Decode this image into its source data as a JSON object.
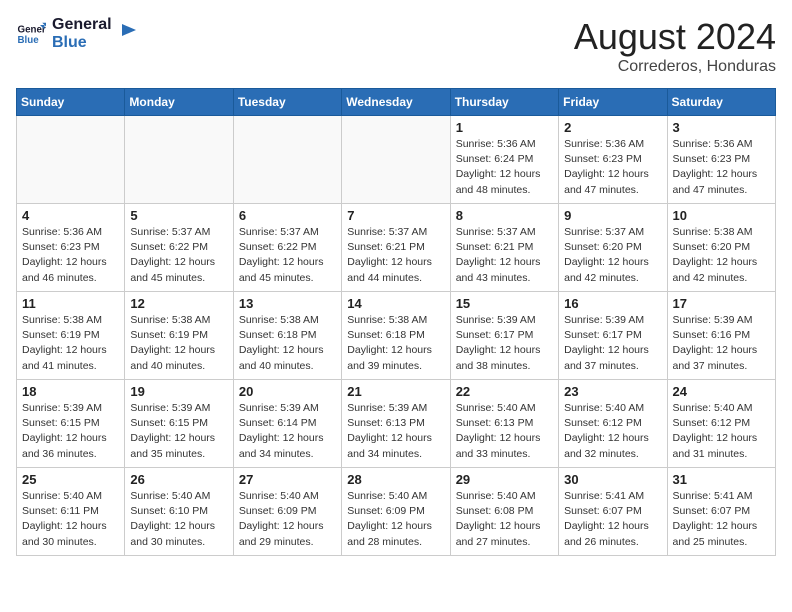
{
  "header": {
    "logo_general": "General",
    "logo_blue": "Blue",
    "month_year": "August 2024",
    "location": "Correderos, Honduras"
  },
  "weekdays": [
    "Sunday",
    "Monday",
    "Tuesday",
    "Wednesday",
    "Thursday",
    "Friday",
    "Saturday"
  ],
  "weeks": [
    [
      {
        "day": "",
        "info": ""
      },
      {
        "day": "",
        "info": ""
      },
      {
        "day": "",
        "info": ""
      },
      {
        "day": "",
        "info": ""
      },
      {
        "day": "1",
        "info": "Sunrise: 5:36 AM\nSunset: 6:24 PM\nDaylight: 12 hours\nand 48 minutes."
      },
      {
        "day": "2",
        "info": "Sunrise: 5:36 AM\nSunset: 6:23 PM\nDaylight: 12 hours\nand 47 minutes."
      },
      {
        "day": "3",
        "info": "Sunrise: 5:36 AM\nSunset: 6:23 PM\nDaylight: 12 hours\nand 47 minutes."
      }
    ],
    [
      {
        "day": "4",
        "info": "Sunrise: 5:36 AM\nSunset: 6:23 PM\nDaylight: 12 hours\nand 46 minutes."
      },
      {
        "day": "5",
        "info": "Sunrise: 5:37 AM\nSunset: 6:22 PM\nDaylight: 12 hours\nand 45 minutes."
      },
      {
        "day": "6",
        "info": "Sunrise: 5:37 AM\nSunset: 6:22 PM\nDaylight: 12 hours\nand 45 minutes."
      },
      {
        "day": "7",
        "info": "Sunrise: 5:37 AM\nSunset: 6:21 PM\nDaylight: 12 hours\nand 44 minutes."
      },
      {
        "day": "8",
        "info": "Sunrise: 5:37 AM\nSunset: 6:21 PM\nDaylight: 12 hours\nand 43 minutes."
      },
      {
        "day": "9",
        "info": "Sunrise: 5:37 AM\nSunset: 6:20 PM\nDaylight: 12 hours\nand 42 minutes."
      },
      {
        "day": "10",
        "info": "Sunrise: 5:38 AM\nSunset: 6:20 PM\nDaylight: 12 hours\nand 42 minutes."
      }
    ],
    [
      {
        "day": "11",
        "info": "Sunrise: 5:38 AM\nSunset: 6:19 PM\nDaylight: 12 hours\nand 41 minutes."
      },
      {
        "day": "12",
        "info": "Sunrise: 5:38 AM\nSunset: 6:19 PM\nDaylight: 12 hours\nand 40 minutes."
      },
      {
        "day": "13",
        "info": "Sunrise: 5:38 AM\nSunset: 6:18 PM\nDaylight: 12 hours\nand 40 minutes."
      },
      {
        "day": "14",
        "info": "Sunrise: 5:38 AM\nSunset: 6:18 PM\nDaylight: 12 hours\nand 39 minutes."
      },
      {
        "day": "15",
        "info": "Sunrise: 5:39 AM\nSunset: 6:17 PM\nDaylight: 12 hours\nand 38 minutes."
      },
      {
        "day": "16",
        "info": "Sunrise: 5:39 AM\nSunset: 6:17 PM\nDaylight: 12 hours\nand 37 minutes."
      },
      {
        "day": "17",
        "info": "Sunrise: 5:39 AM\nSunset: 6:16 PM\nDaylight: 12 hours\nand 37 minutes."
      }
    ],
    [
      {
        "day": "18",
        "info": "Sunrise: 5:39 AM\nSunset: 6:15 PM\nDaylight: 12 hours\nand 36 minutes."
      },
      {
        "day": "19",
        "info": "Sunrise: 5:39 AM\nSunset: 6:15 PM\nDaylight: 12 hours\nand 35 minutes."
      },
      {
        "day": "20",
        "info": "Sunrise: 5:39 AM\nSunset: 6:14 PM\nDaylight: 12 hours\nand 34 minutes."
      },
      {
        "day": "21",
        "info": "Sunrise: 5:39 AM\nSunset: 6:13 PM\nDaylight: 12 hours\nand 34 minutes."
      },
      {
        "day": "22",
        "info": "Sunrise: 5:40 AM\nSunset: 6:13 PM\nDaylight: 12 hours\nand 33 minutes."
      },
      {
        "day": "23",
        "info": "Sunrise: 5:40 AM\nSunset: 6:12 PM\nDaylight: 12 hours\nand 32 minutes."
      },
      {
        "day": "24",
        "info": "Sunrise: 5:40 AM\nSunset: 6:12 PM\nDaylight: 12 hours\nand 31 minutes."
      }
    ],
    [
      {
        "day": "25",
        "info": "Sunrise: 5:40 AM\nSunset: 6:11 PM\nDaylight: 12 hours\nand 30 minutes."
      },
      {
        "day": "26",
        "info": "Sunrise: 5:40 AM\nSunset: 6:10 PM\nDaylight: 12 hours\nand 30 minutes."
      },
      {
        "day": "27",
        "info": "Sunrise: 5:40 AM\nSunset: 6:09 PM\nDaylight: 12 hours\nand 29 minutes."
      },
      {
        "day": "28",
        "info": "Sunrise: 5:40 AM\nSunset: 6:09 PM\nDaylight: 12 hours\nand 28 minutes."
      },
      {
        "day": "29",
        "info": "Sunrise: 5:40 AM\nSunset: 6:08 PM\nDaylight: 12 hours\nand 27 minutes."
      },
      {
        "day": "30",
        "info": "Sunrise: 5:41 AM\nSunset: 6:07 PM\nDaylight: 12 hours\nand 26 minutes."
      },
      {
        "day": "31",
        "info": "Sunrise: 5:41 AM\nSunset: 6:07 PM\nDaylight: 12 hours\nand 25 minutes."
      }
    ]
  ]
}
